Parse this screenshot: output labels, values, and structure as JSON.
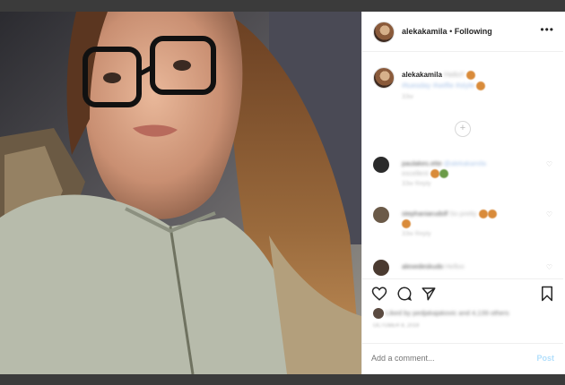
{
  "post": {
    "username": "alekakamila",
    "follow_sep": "•",
    "follow_status": "Following",
    "more_glyph": "•••",
    "caption_user": "alekakamila",
    "caption_text": "Hello!!",
    "caption_tags": "#tuesday #selfie #style",
    "caption_time": "33w",
    "load_more_glyph": "+"
  },
  "comments": [
    {
      "user": "paulakes.ette",
      "text": "@alekakamila",
      "text2": "excellent",
      "meta": "33w   Reply"
    },
    {
      "user": "stephaniarudolf",
      "text": "So pretty",
      "text2": "",
      "meta": "33w   Reply"
    },
    {
      "user": "alexedeskudo",
      "text": "Helloo",
      "text2": "",
      "meta": ""
    }
  ],
  "likes": {
    "text": "Liked by pedjakajakovic and 4,139 others"
  },
  "date": "OCTOBER 8, 2019",
  "add_comment": {
    "placeholder": "Add a comment...",
    "post_label": "Post"
  },
  "colors": {
    "accent": "#b2dffc",
    "text": "#262626",
    "muted": "#8e8e8e"
  }
}
